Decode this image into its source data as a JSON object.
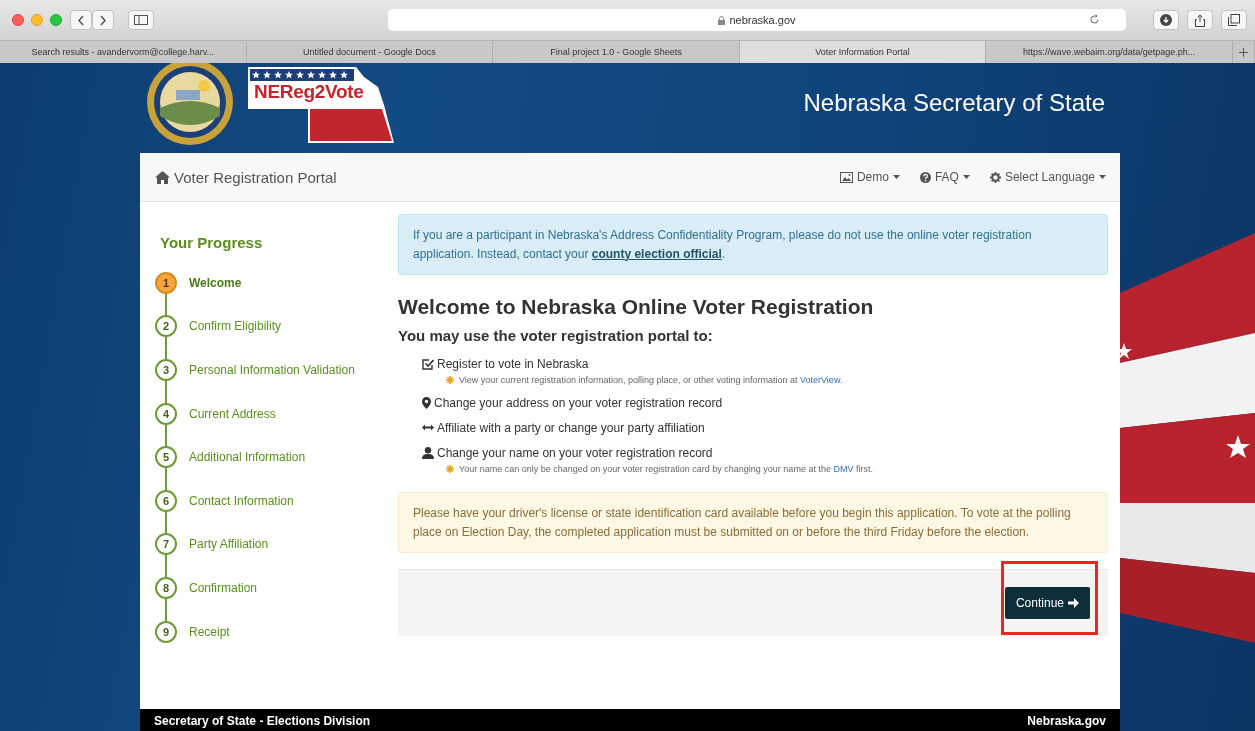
{
  "browser": {
    "address": "nebraska.gov",
    "tabs": [
      {
        "label": "Search results - avandervorm@college.harv...",
        "selected": false
      },
      {
        "label": "Untitled document - Google Docs",
        "selected": false
      },
      {
        "label": "Final project 1.0 - Google Sheets",
        "selected": false
      },
      {
        "label": "Voter Information Portal",
        "selected": true
      },
      {
        "label": "https://wave.webaim.org/data/getpage.ph...",
        "selected": false
      }
    ]
  },
  "header": {
    "logo_text": "NEReg2Vote",
    "title": "Nebraska Secretary of State"
  },
  "navbar": {
    "brand": "Voter Registration Portal",
    "menus": [
      {
        "kind": "picture",
        "label": "Demo"
      },
      {
        "kind": "question",
        "label": "FAQ"
      },
      {
        "kind": "gear",
        "label": "Select Language"
      }
    ]
  },
  "progress": {
    "title": "Your Progress",
    "steps": [
      {
        "number": "1",
        "label": "Welcome",
        "current": true
      },
      {
        "number": "2",
        "label": "Confirm Eligibility",
        "current": false
      },
      {
        "number": "3",
        "label": "Personal Information Validation",
        "current": false
      },
      {
        "number": "4",
        "label": "Current Address",
        "current": false
      },
      {
        "number": "5",
        "label": "Additional Information",
        "current": false
      },
      {
        "number": "6",
        "label": "Contact Information",
        "current": false
      },
      {
        "number": "7",
        "label": "Party Affiliation",
        "current": false
      },
      {
        "number": "8",
        "label": "Confirmation",
        "current": false
      },
      {
        "number": "9",
        "label": "Receipt",
        "current": false
      }
    ]
  },
  "info_alert": {
    "text_before": "If you are a participant in Nebraska's Address Confidentiality Program, please do not use the online voter registration application. Instead, contact your ",
    "link": "county election official",
    "text_after": "."
  },
  "heading": "Welcome to Nebraska Online Voter Registration",
  "subheading": "You may use the voter registration portal to:",
  "uses": [
    {
      "kind": "check",
      "text": "Register to vote in Nebraska",
      "note": {
        "text_before": "View your current registration information, polling place, or other voting information at ",
        "link": "VoterView",
        "text_after": "."
      }
    },
    {
      "kind": "pin",
      "text": "Change your address on your voter registration record"
    },
    {
      "kind": "arrows",
      "text": "Affiliate with a party or change your party affiliation"
    },
    {
      "kind": "person",
      "text": "Change your name on your voter registration record",
      "note": {
        "text_before": "Your name can only be changed on your voter registration card by changing your name at the ",
        "link": "DMV",
        "text_after": " first."
      }
    }
  ],
  "warning_alert": "Please have your driver's license or state identification card available before you begin this application. To vote at the polling place on Election Day, the completed application must be submitted on or before the third Friday before the election.",
  "continue_button": {
    "label": "Continue",
    "highlighted": true
  },
  "footer": {
    "left": "Secretary of State - Elections Division",
    "right": "Nebraska.gov"
  }
}
